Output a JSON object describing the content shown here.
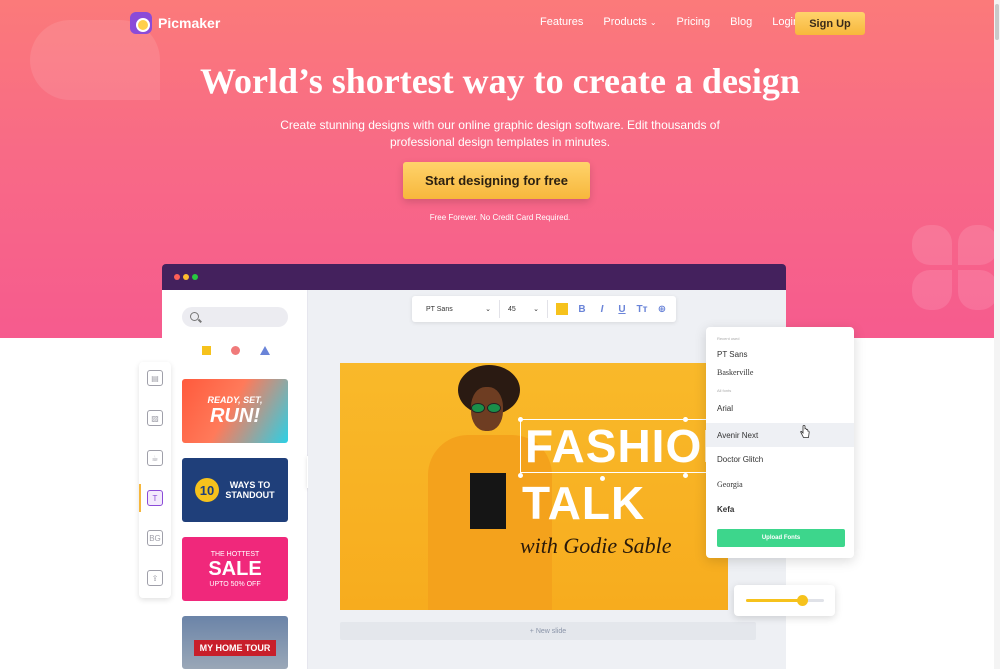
{
  "brand": {
    "name": "Picmaker"
  },
  "nav": {
    "items": [
      "Features",
      "Products",
      "Pricing",
      "Blog",
      "Login"
    ],
    "signup_label": "Sign Up"
  },
  "hero": {
    "title": "World’s shortest way to create a design",
    "subtitle": "Create stunning designs with our online graphic design software. Edit thousands of professional design templates in minutes.",
    "cta_label": "Start designing for free",
    "cta_note": "Free Forever. No Credit Card Required."
  },
  "editor": {
    "toolbar": {
      "font": "PT Sans",
      "size": "45",
      "format_buttons": [
        "B",
        "I",
        "U",
        "Tт"
      ],
      "highlight_color": "#f6c21c"
    },
    "tools": [
      {
        "name": "templates-icon",
        "glyph": "▤"
      },
      {
        "name": "image-icon",
        "glyph": "▨"
      },
      {
        "name": "cup-icon",
        "glyph": "☕"
      },
      {
        "name": "text-icon",
        "glyph": "T"
      },
      {
        "name": "background-icon",
        "glyph": "BG"
      },
      {
        "name": "upload-icon",
        "glyph": "⇪"
      }
    ],
    "templates": [
      {
        "line1": "READY, SET,",
        "line2": "RUN!"
      },
      {
        "badge": "10",
        "text": "WAYS TO STANDOUT"
      },
      {
        "top": "THE HOTTEST",
        "mid": "SALE",
        "bottom": "UPTO 50% OFF"
      },
      {
        "label": "MY HOME TOUR"
      }
    ],
    "design": {
      "line1": "FASHION",
      "line2": "TALK",
      "signature": "with Godie Sable"
    },
    "new_slide_label": "+ New slide",
    "font_panel": {
      "section1": "Recent used",
      "section1_fonts": [
        "PT Sans",
        "Baskerville"
      ],
      "section2": "All fonts",
      "section2_fonts": [
        "Arial",
        "Avenir Next",
        "Doctor Glitch",
        "Georgia",
        "Kefa"
      ],
      "upload_label": "Upload Fonts"
    },
    "slider": {
      "value": 0.72
    }
  }
}
